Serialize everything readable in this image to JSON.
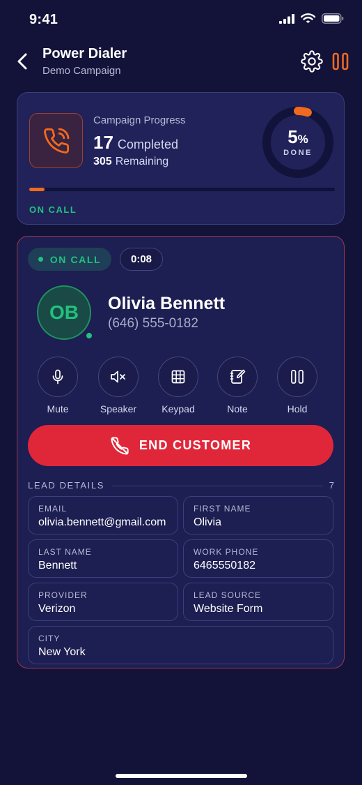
{
  "status_bar": {
    "time": "9:41"
  },
  "header": {
    "title": "Power Dialer",
    "subtitle": "Demo Campaign"
  },
  "campaign": {
    "label": "Campaign Progress",
    "completed_count": "17",
    "completed_label": "Completed",
    "remaining_count": "305",
    "remaining_label": "Remaining",
    "percent": "5",
    "percent_sign": "%",
    "done_label": "DONE",
    "progress_fraction": 0.05,
    "status": "ON CALL"
  },
  "call": {
    "status": "ON CALL",
    "timer": "0:08",
    "initials": "OB",
    "name": "Olivia Bennett",
    "phone": "(646) 555-0182"
  },
  "controls": [
    {
      "label": "Mute",
      "icon": "microphone-icon"
    },
    {
      "label": "Speaker",
      "icon": "speaker-muted-icon"
    },
    {
      "label": "Keypad",
      "icon": "keypad-icon"
    },
    {
      "label": "Note",
      "icon": "note-icon"
    },
    {
      "label": "Hold",
      "icon": "pause-icon"
    }
  ],
  "end_button": {
    "label": "END CUSTOMER"
  },
  "lead": {
    "title": "LEAD DETAILS",
    "count": "7",
    "fields": [
      {
        "label": "EMAIL",
        "value": "olivia.bennett@gmail.com"
      },
      {
        "label": "FIRST NAME",
        "value": "Olivia"
      },
      {
        "label": "LAST NAME",
        "value": "Bennett"
      },
      {
        "label": "WORK PHONE",
        "value": "6465550182"
      },
      {
        "label": "PROVIDER",
        "value": "Verizon"
      },
      {
        "label": "LEAD SOURCE",
        "value": "Website Form"
      },
      {
        "label": "CITY",
        "value": "New York"
      }
    ]
  },
  "colors": {
    "background": "#13133a",
    "accent_orange": "#f06a1e",
    "success_green": "#22c17d",
    "danger_red": "#e0273a"
  }
}
